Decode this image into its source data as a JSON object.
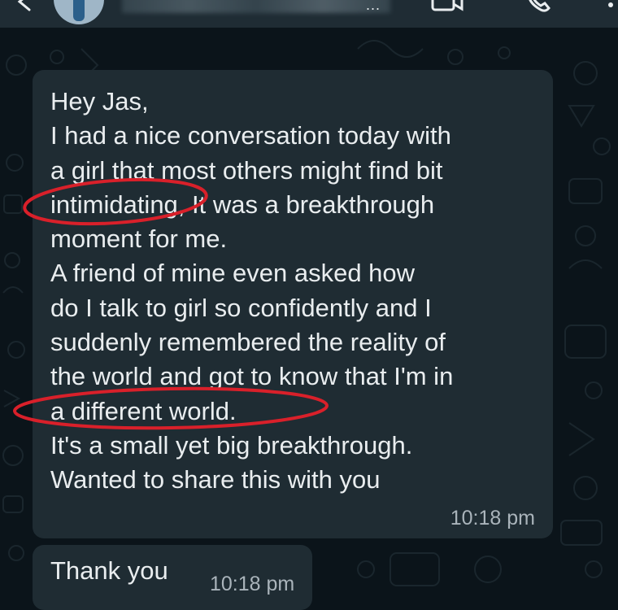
{
  "header": {
    "contact_more": "...",
    "icons": [
      "back-arrow-icon",
      "avatar",
      "video-call-icon",
      "voice-call-icon",
      "more-options-icon"
    ]
  },
  "messages": [
    {
      "text": "Hey Jas,\nI had a nice conversation today with\na girl that most others might find bit\nintimidating, It was a breakthrough\nmoment for me.\nA friend of mine even asked how\ndo I talk to girl so confidently and I\nsuddenly remembered the reality of\nthe world and got to know that I'm in\na different world.\nIt's a small yet big breakthrough.\nWanted to share this with you",
      "time": "10:18 pm"
    },
    {
      "text": "Thank you",
      "time": "10:18 pm"
    }
  ],
  "colors": {
    "chat_background": "#0b141a",
    "bubble": "#1f2c33",
    "text": "#e9edef",
    "timestamp": "#aab4bb",
    "annotation": "#d9202a"
  }
}
